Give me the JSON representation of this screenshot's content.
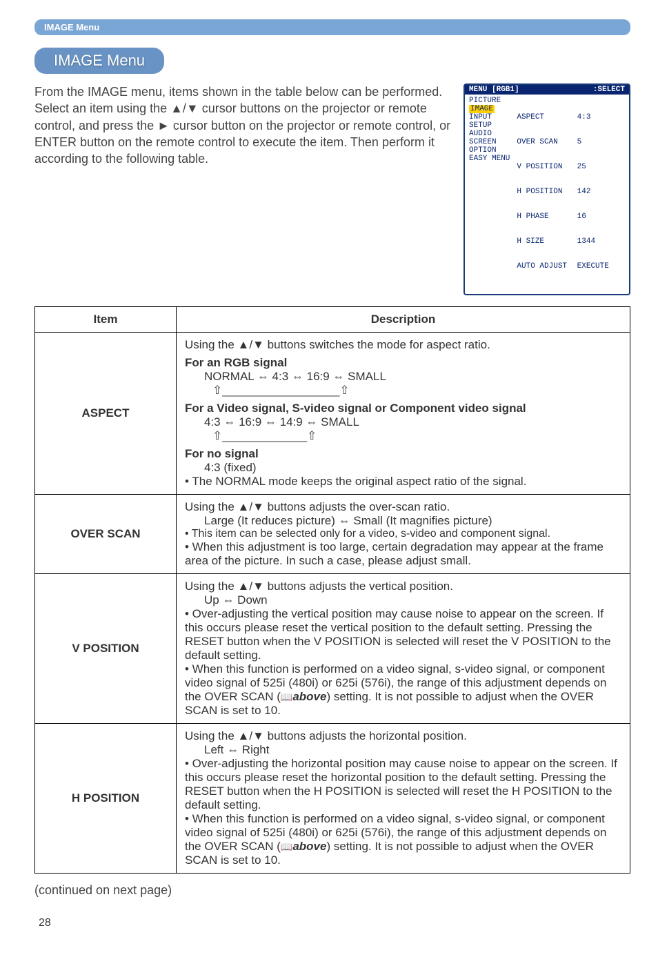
{
  "topbar": {
    "label": "IMAGE Menu"
  },
  "pill": {
    "title": "IMAGE Menu"
  },
  "intro": {
    "p1": "From the IMAGE menu, items shown in the table below can be performed.",
    "p2": "Select an item using the ▲/▼ cursor buttons on the projector or remote control, and press the ► cursor button on the projector or remote control, or ENTER button on the remote control to execute the item. Then perform it according to the following table."
  },
  "osd": {
    "header_left": "MENU [RGB1]",
    "header_right": ":SELECT",
    "left": [
      "PICTURE",
      "IMAGE",
      "INPUT",
      "SETUP",
      "AUDIO",
      "SCREEN",
      "OPTION",
      "EASY MENU"
    ],
    "right_labels": [
      "ASPECT",
      "OVER SCAN",
      "V POSITION",
      "H POSITION",
      "H PHASE",
      "H SIZE",
      "AUTO ADJUST"
    ],
    "right_values": [
      "4:3",
      "5",
      "25",
      "142",
      "16",
      "1344",
      "EXECUTE"
    ]
  },
  "table": {
    "head_item": "Item",
    "head_desc": "Description",
    "rows": [
      {
        "item": "ASPECT",
        "desc_intro": "Using the ▲/▼ buttons switches the mode for aspect ratio.",
        "rgb_label": "For an RGB signal",
        "rgb_line": "NORMAL ⇔ 4:3 ⇔ 16:9 ⇔ SMALL",
        "video_label": "For a Video signal, S-video signal or Component video signal",
        "video_line": "4:3 ⇔ 16:9 ⇔ 14:9 ⇔ SMALL",
        "nosig_label": "For no signal",
        "nosig_line": "4:3 (fixed)",
        "note": "• The NORMAL mode keeps the original aspect ratio of the signal."
      },
      {
        "item": "OVER SCAN",
        "l1": "Using the ▲/▼ buttons adjusts the over-scan ratio.",
        "l2": "Large (It reduces picture) ⇔ Small (It magnifies picture)",
        "l3": "• This item can be selected only for a video, s-video and component signal.",
        "l4": "• When this adjustment is too large, certain degradation may appear at the frame area of the picture. In such a case, please adjust small."
      },
      {
        "item": "V POSITION",
        "l1": "Using the ▲/▼ buttons adjusts the vertical position.",
        "l2": "Up ⇔ Down",
        "l3": "• Over-adjusting the vertical position may cause noise to appear on the screen. If this occurs please reset the vertical position to the default setting. Pressing the RESET button when the V POSITION is selected will reset the V POSITION to the default setting.",
        "l4a": "• When this function is performed on a video signal, s-video signal, or component video signal of 525i (480i) or 625i (576i), the range of this adjustment depends on the OVER SCAN (",
        "l4b": "above",
        "l4c": ") setting. It is not possible to adjust when the OVER SCAN is set to 10."
      },
      {
        "item": "H POSITION",
        "l1": "Using the ▲/▼ buttons adjusts the horizontal position.",
        "l2": "Left ⇔ Right",
        "l3": "• Over-adjusting the horizontal position may cause noise to appear on the screen. If this occurs please reset the horizontal position to the default setting. Pressing the RESET button when the H POSITION is selected will reset the H POSITION to the default setting.",
        "l4a": "• When this function is performed on a video signal, s-video signal, or component video signal of 525i (480i) or 625i (576i), the range of this adjustment depends on the OVER SCAN (",
        "l4b": "above",
        "l4c": ") setting. It is not possible to adjust when the OVER SCAN is set to 10."
      }
    ]
  },
  "continued": "(continued on next page)",
  "page_number": "28"
}
